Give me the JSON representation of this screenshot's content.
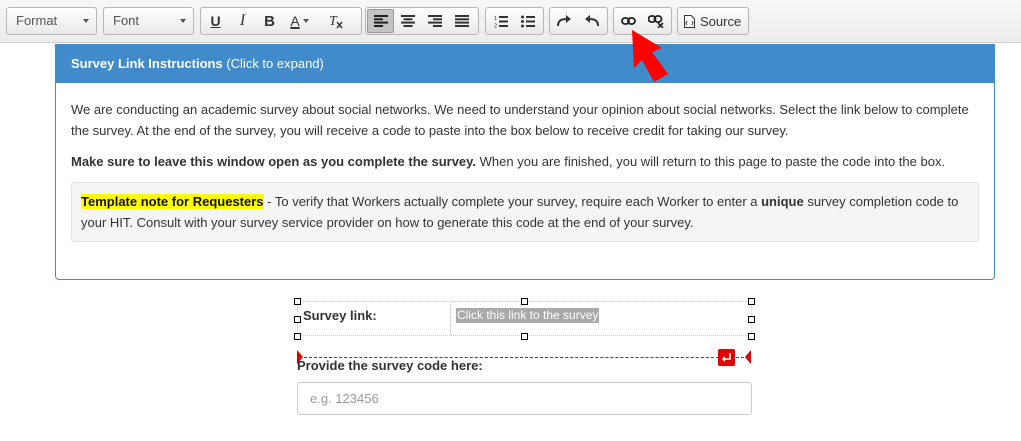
{
  "toolbar": {
    "format_label": "Format",
    "font_label": "Font",
    "source_label": "Source",
    "text_color_glyph": "A"
  },
  "panel": {
    "title_bold": "Survey Link Instructions",
    "title_hint": "(Click to expand)",
    "paragraph1": "We are conducting an academic survey about social networks. We need to understand your opinion about social networks. Select the link below to complete the survey. At the end of the survey, you will receive a code to paste into the box below to receive credit for taking our survey.",
    "paragraph2_bold": "Make sure to leave this window open as you complete the survey.",
    "paragraph2_rest": " When you are finished, you will return to this page to paste the code into the box.",
    "note_highlight": "Template note for Requesters",
    "note_part1": " - To verify that Workers actually complete your survey, require each Worker to enter a ",
    "note_bold": "unique",
    "note_part2": " survey completion code to your HIT. Consult with your survey service provider on how to generate this code at the end of your survey."
  },
  "survey": {
    "link_label": "Survey link:",
    "link_text": "Click this link to the survey",
    "code_label": "Provide the survey code here:",
    "code_placeholder": "e.g. 123456",
    "code_value": ""
  },
  "colors": {
    "panel_blue": "#428bca",
    "highlight": "#ffff00",
    "magicline_red": "#e00000",
    "arrow_red": "#ff0000"
  }
}
